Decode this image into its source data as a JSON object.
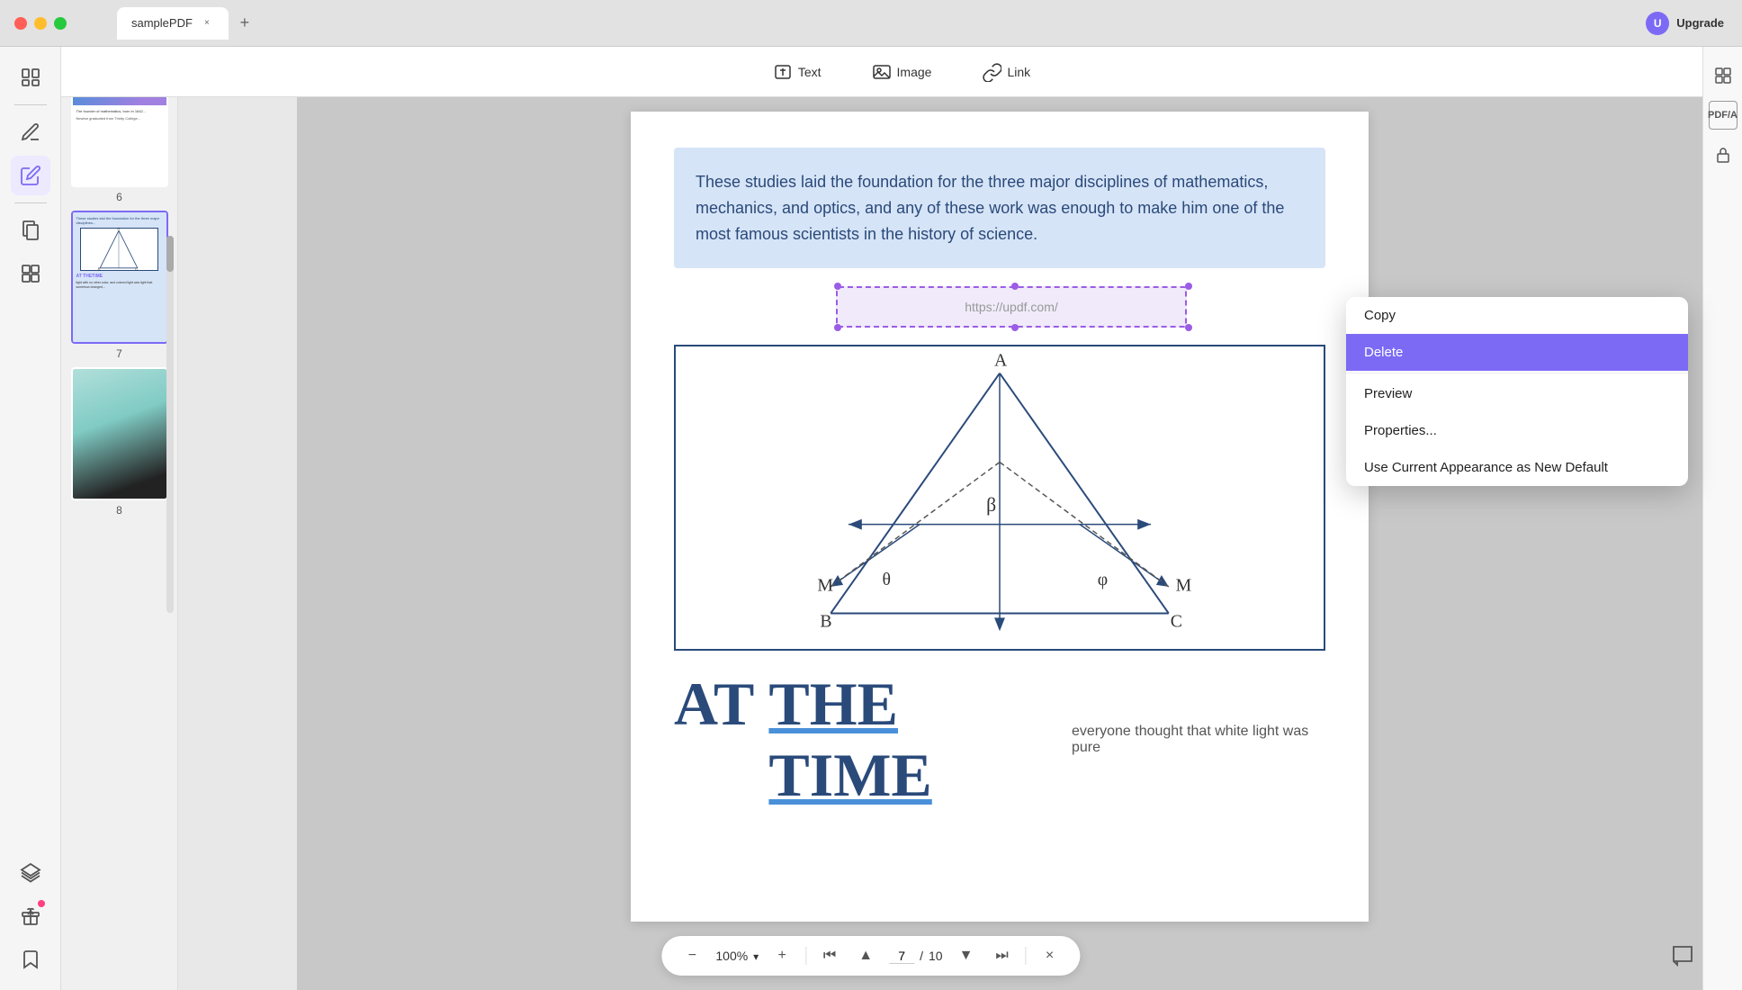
{
  "titlebar": {
    "tab_title": "samplePDF",
    "tab_close": "×",
    "tab_new": "+",
    "upgrade_label": "Upgrade",
    "avatar_initial": "U"
  },
  "toolbar": {
    "text_label": "Text",
    "image_label": "Image",
    "link_label": "Link",
    "text_icon": "T",
    "image_icon": "🖼",
    "link_icon": "🔗"
  },
  "sidebar_icons": [
    {
      "name": "read-icon",
      "glyph": "📖",
      "active": false
    },
    {
      "name": "edit-icon",
      "glyph": "✏️",
      "active": false
    },
    {
      "name": "annotate-icon",
      "glyph": "🖊",
      "active": true
    },
    {
      "name": "pages-icon",
      "glyph": "📄",
      "active": false
    },
    {
      "name": "convert-icon",
      "glyph": "🔄",
      "active": false
    },
    {
      "name": "layers-icon",
      "glyph": "◻",
      "active": false
    },
    {
      "name": "bookmark-icon",
      "glyph": "🔖",
      "active": false
    }
  ],
  "right_icons": [
    {
      "name": "properties-icon",
      "glyph": "⊞"
    },
    {
      "name": "pdf-a-icon",
      "glyph": "A"
    },
    {
      "name": "security-icon",
      "glyph": "🔒"
    }
  ],
  "thumbnails": [
    {
      "page": "6"
    },
    {
      "page": "7",
      "selected": true
    },
    {
      "page": "8"
    }
  ],
  "pdf_content": {
    "paragraph": "These studies laid the foundation for the three major disciplines of mathematics, mechanics, and optics, and any of these work was enough to make him one of the most famous scientists in the history of science.",
    "link_url": "https://updf.com/",
    "at_the_time": "AT THE TIME",
    "subtext": "everyone thought that white light was pure"
  },
  "context_menu": {
    "items": [
      {
        "label": "Copy",
        "highlighted": false
      },
      {
        "label": "Delete",
        "highlighted": true
      },
      {
        "label": "Preview",
        "highlighted": false
      },
      {
        "label": "Properties...",
        "highlighted": false
      },
      {
        "label": "Use Current Appearance as New Default",
        "highlighted": false
      }
    ]
  },
  "bottom_toolbar": {
    "zoom_out": "−",
    "zoom_level": "100%",
    "zoom_in": "+",
    "page_current": "7",
    "page_total": "10",
    "first_page": "⏮",
    "prev_page": "⏫",
    "next_page": "⏬",
    "last_page": "⏭",
    "close": "×",
    "separator": "/"
  }
}
